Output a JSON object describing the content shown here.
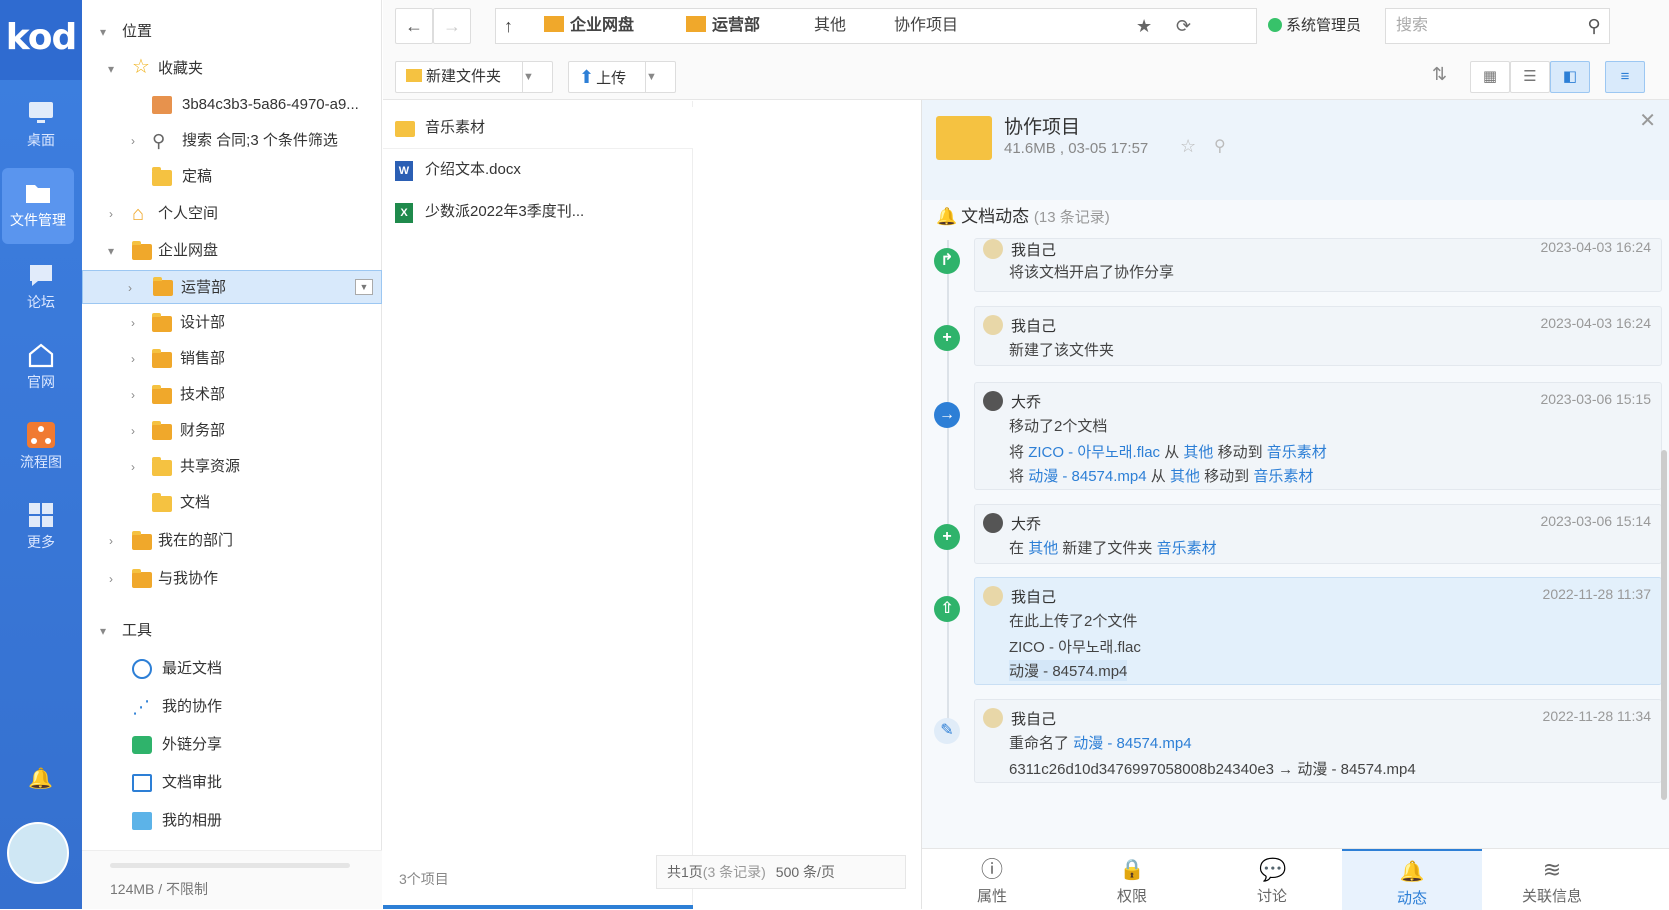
{
  "rail": {
    "logo": "kod",
    "items": [
      {
        "label": "桌面"
      },
      {
        "label": "文件管理"
      },
      {
        "label": "论坛"
      },
      {
        "label": "官网"
      },
      {
        "label": "流程图"
      },
      {
        "label": "更多"
      }
    ]
  },
  "tree": {
    "location": "位置",
    "favorites": "收藏夹",
    "fav1": "3b84c3b3-5a86-4970-a9...",
    "fav2": "搜索 合同;3 个条件筛选",
    "fav3": "定稿",
    "personal": "个人空间",
    "enterprise": "企业网盘",
    "depts": [
      "运营部",
      "设计部",
      "销售部",
      "技术部",
      "财务部",
      "共享资源",
      "文档"
    ],
    "mydept": "我在的部门",
    "collab": "与我协作",
    "tools": "工具",
    "toolitems": [
      "最近文档",
      "我的协作",
      "外链分享",
      "文档审批",
      "我的相册"
    ],
    "usage": "124MB / 不限制"
  },
  "toolbar": {
    "new_folder": "新建文件夹",
    "upload": "上传",
    "crumbs": [
      "企业网盘",
      "运营部",
      "其他",
      "协作项目"
    ],
    "user": "系统管理员",
    "search_placeholder": "搜索"
  },
  "files": {
    "items": [
      "音乐素材",
      "介绍文本.docx",
      "少数派2022年3季度刊..."
    ],
    "count": "3个项目",
    "pages": "共1页",
    "records": "(3 条记录)",
    "perpage": "500 条/页"
  },
  "detail": {
    "name": "协作项目",
    "meta": "41.6MB , 03-05 17:57",
    "section": "文档动态",
    "section_count": "(13 条记录)",
    "activities": [
      {
        "who": "我自己",
        "time": "2023-04-03 16:24",
        "text": "将该文档开启了协作分享"
      },
      {
        "who": "我自己",
        "time": "2023-04-03 16:24",
        "text": "新建了该文件夹"
      },
      {
        "who": "大乔",
        "time": "2023-03-06 15:15",
        "text": "移动了2个文档",
        "l1a": "将",
        "l1b": "ZICO - 아무노래.flac",
        "l1c": "从",
        "l1d": "其他",
        "l1e": "移动到",
        "l1f": "音乐素材",
        "l2a": "将",
        "l2b": "动漫 - 84574.mp4",
        "l2c": "从",
        "l2d": "其他",
        "l2e": "移动到",
        "l2f": "音乐素材"
      },
      {
        "who": "大乔",
        "time": "2023-03-06 15:14",
        "t1": "在",
        "t2": "其他",
        "t3": "新建了文件夹",
        "t4": "音乐素材"
      },
      {
        "who": "我自己",
        "time": "2022-11-28 11:37",
        "text": "在此上传了2个文件",
        "f1": "ZICO - 아무노래.flac",
        "f2": "动漫 - 84574.mp4"
      },
      {
        "who": "我自己",
        "time": "2022-11-28 11:34",
        "t1": "重命名了",
        "t2": "动漫 - 84574.mp4",
        "t3": "6311c26d10d3476997058008b24340e3 → 动漫 - 84574.mp4"
      }
    ],
    "tabs": [
      "属性",
      "权限",
      "讨论",
      "动态",
      "关联信息"
    ]
  }
}
